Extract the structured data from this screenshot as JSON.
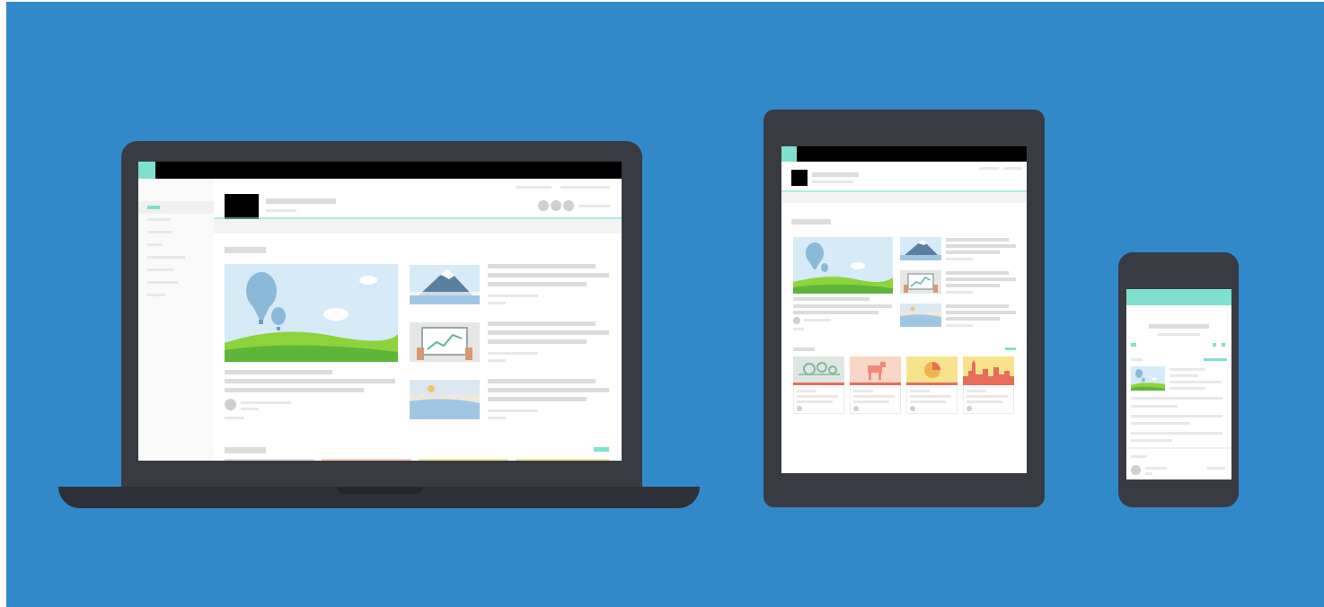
{
  "colors": {
    "background": "#3189c9",
    "device_body": "#393b43",
    "laptop_base": "#2e3037",
    "screen": "#ffffff",
    "accent": "#7fe0cf",
    "placeholder": "#dcdcdc",
    "sky": "#d6eaf7",
    "hill_light": "#8dd43c",
    "hill_dark": "#5db63a",
    "balloon": "#8ab9da"
  },
  "devices": [
    {
      "kind": "laptop",
      "icon": "laptop-icon"
    },
    {
      "kind": "tablet",
      "icon": "tablet-icon"
    },
    {
      "kind": "phone",
      "icon": "phone-icon"
    }
  ],
  "illustrations": [
    "balloon-landscape-icon",
    "mountain-icon",
    "chart-screen-icon",
    "beach-icon",
    "gears-icon",
    "pie-chart-icon",
    "city-skyline-icon"
  ]
}
